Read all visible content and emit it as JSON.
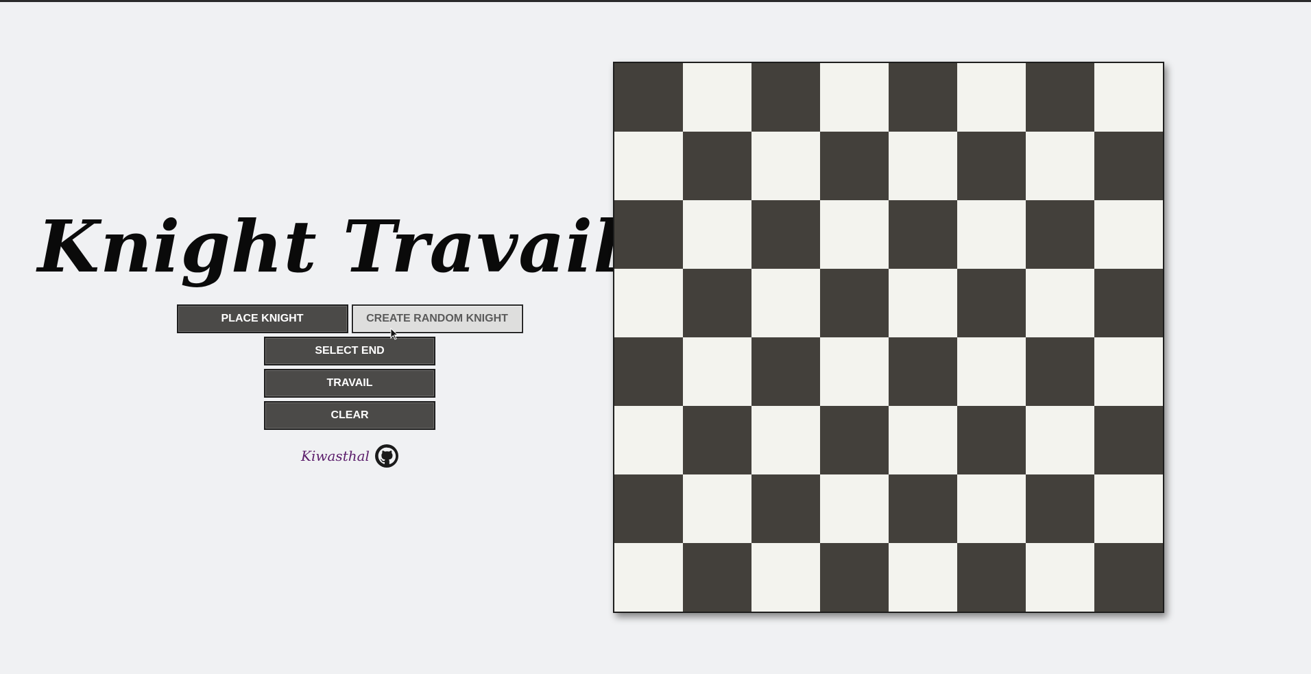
{
  "app": {
    "title": "Knight Travails"
  },
  "controls": {
    "place_knight": "PLACE KNIGHT",
    "create_random_knight": "CREATE RANDOM KNIGHT",
    "select_end": "SELECT END",
    "travail": "TRAVAIL",
    "clear": "CLEAR"
  },
  "footer": {
    "author": "Kiwasthal",
    "github_icon": "github-icon"
  },
  "board": {
    "size": 8,
    "dark_color": "#43403b",
    "light_color": "#f3f3ee",
    "top_left": "dark"
  },
  "colors": {
    "background": "#f0f1f3",
    "button_dark": "#4b4a48",
    "button_hover": "#dededd",
    "author": "#5b1d6b"
  }
}
